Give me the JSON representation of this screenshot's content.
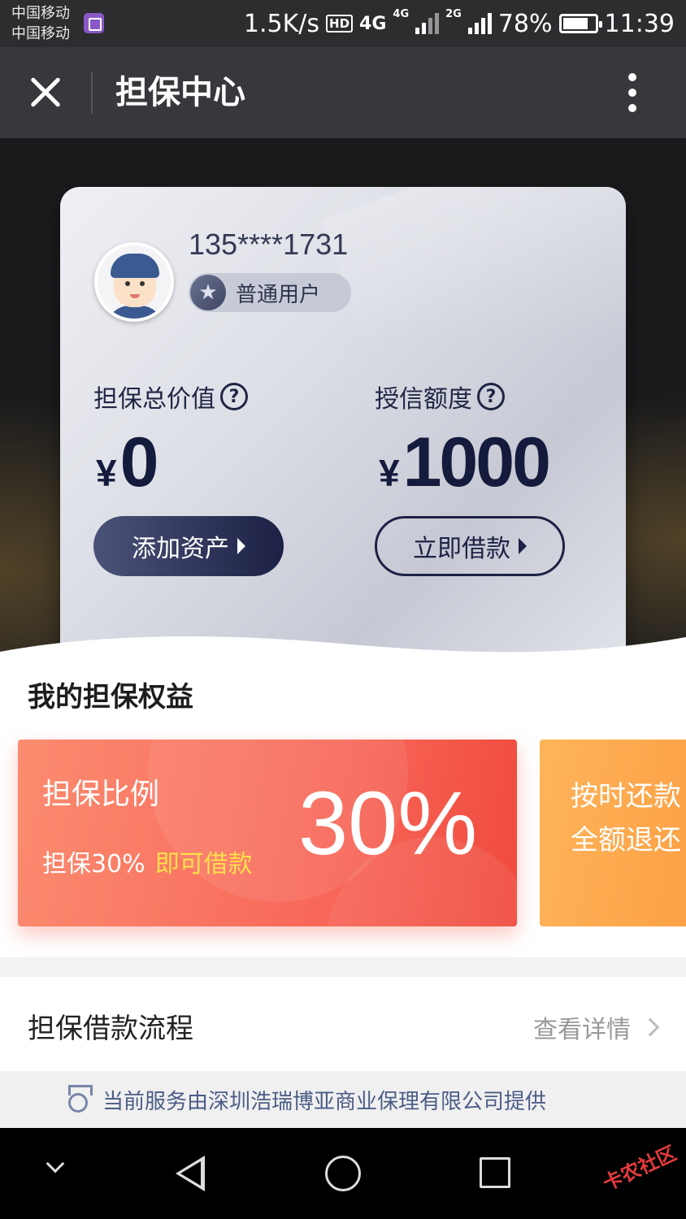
{
  "status_bar": {
    "carrier1": "中国移动",
    "carrier2": "中国移动",
    "speed": "1.5K/s",
    "hd": "HD",
    "net1": "4G",
    "net2": "4G",
    "net3": "2G",
    "battery": "78%",
    "time": "11:39"
  },
  "nav": {
    "title": "担保中心",
    "close_icon": "close-icon",
    "more_icon": "more-vertical-icon"
  },
  "card": {
    "phone": "135****1731",
    "user_level": "普通用户",
    "total_label": "担保总价值",
    "total_currency": "¥",
    "total_value": "0",
    "credit_label": "授信额度",
    "credit_currency": "¥",
    "credit_value": "1000",
    "add_button": "添加资产",
    "borrow_button": "立即借款",
    "help_glyph": "?"
  },
  "benefits": {
    "title": "我的担保权益",
    "items": [
      {
        "title": "担保比例",
        "sub": "担保30%",
        "highlight": "即可借款",
        "big": "30%"
      },
      {
        "line1": "按时还款",
        "line2": "全额退还"
      }
    ]
  },
  "process": {
    "title": "担保借款流程",
    "link": "查看详情"
  },
  "footer": {
    "text": "当前服务由深圳浩瑞博亚商业保理有限公司提供"
  },
  "watermark": "卡农社区",
  "colors": {
    "accent_dark": "#1c2145",
    "benefit_red": "#f8695a",
    "benefit_orange": "#fb9a3e",
    "highlight_yellow": "#ffe04a"
  }
}
